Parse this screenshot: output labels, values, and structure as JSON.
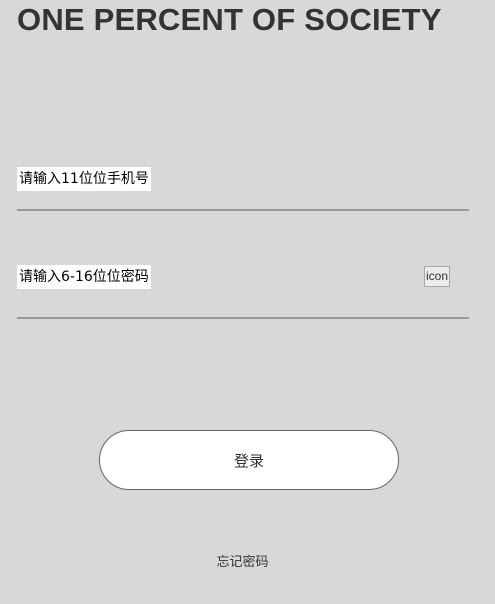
{
  "brand": {
    "title": "ONE PERCENT OF SOCIETY"
  },
  "form": {
    "phone": {
      "placeholder": "请输入11位位手机号",
      "value": ""
    },
    "password": {
      "placeholder": "请输入6-16位位密码",
      "value": "",
      "toggle_icon": "icon",
      "toggle_icon_name": "show-password-icon"
    },
    "login_label": "登录",
    "forgot_label": "忘记密码"
  },
  "colors": {
    "background": "#d8d8d8",
    "text": "#333333",
    "underline": "#999999",
    "button_bg": "#ffffff"
  }
}
